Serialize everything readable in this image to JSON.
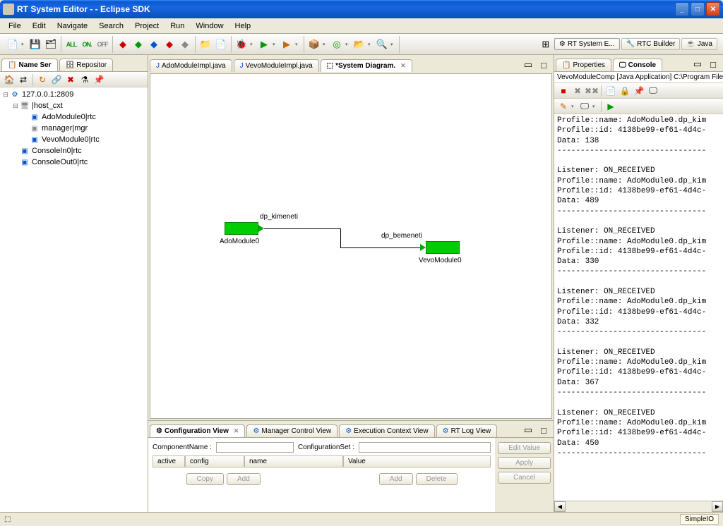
{
  "window": {
    "title": "RT System Editor -  - Eclipse SDK"
  },
  "menu": [
    "File",
    "Edit",
    "Navigate",
    "Search",
    "Project",
    "Run",
    "Window",
    "Help"
  ],
  "toolbar": {
    "all": "ALL",
    "on": "ON.",
    "off": "OFF"
  },
  "perspectives": [
    {
      "label": "RT System E...",
      "active": true
    },
    {
      "label": "RTC Builder",
      "active": false
    },
    {
      "label": "Java",
      "active": false
    }
  ],
  "left_view": {
    "tabs": [
      {
        "label": "Name Ser",
        "active": true
      },
      {
        "label": "Repositor",
        "active": false
      }
    ],
    "tree": {
      "root": "127.0.0.1:2809",
      "host": "|host_cxt",
      "children": [
        "AdoModule0|rtc",
        "manager|mgr",
        "VevoModule0|rtc"
      ],
      "siblings": [
        "ConsoleIn0|rtc",
        "ConsoleOut0|rtc"
      ]
    }
  },
  "editor": {
    "tabs": [
      {
        "label": "AdoModuleImpl.java",
        "active": false
      },
      {
        "label": "VevoModuleImpl.java",
        "active": false
      },
      {
        "label": "*System Diagram.",
        "active": true
      }
    ],
    "diagram": {
      "comp1": {
        "label": "AdoModule0"
      },
      "comp2": {
        "label": "VevoModule0"
      },
      "port_out": "dp_kimeneti",
      "port_in": "dp_bemeneti"
    }
  },
  "bottom_view": {
    "tabs": [
      "Configuration View",
      "Manager Control View",
      "Execution Context View",
      "RT Log View"
    ],
    "config": {
      "componentNameLabel": "ComponentName :",
      "configurationSetLabel": "ConfigurationSet :",
      "componentName": "",
      "configurationSet": "",
      "columns": [
        "active",
        "config",
        "name",
        "Value"
      ],
      "buttons": {
        "copy": "Copy",
        "add": "Add",
        "add2": "Add",
        "delete": "Delete",
        "editValue": "Edit Value",
        "apply": "Apply",
        "cancel": "Cancel"
      }
    }
  },
  "right_view": {
    "tabs": [
      {
        "label": "Properties",
        "active": false
      },
      {
        "label": "Console",
        "active": true
      }
    ],
    "console_info": "VevoModuleComp [Java Application] C:\\Program Files\\Ja",
    "console_output": "Profile::name: AdoModule0.dp_kim\nProfile::id: 4138be99-ef61-4d4c-\nData: 138\n--------------------------------\n\nListener: ON_RECEIVED\nProfile::name: AdoModule0.dp_kim\nProfile::id: 4138be99-ef61-4d4c-\nData: 489\n--------------------------------\n\nListener: ON_RECEIVED\nProfile::name: AdoModule0.dp_kim\nProfile::id: 4138be99-ef61-4d4c-\nData: 330\n--------------------------------\n\nListener: ON_RECEIVED\nProfile::name: AdoModule0.dp_kim\nProfile::id: 4138be99-ef61-4d4c-\nData: 332\n--------------------------------\n\nListener: ON_RECEIVED\nProfile::name: AdoModule0.dp_kim\nProfile::id: 4138be99-ef61-4d4c-\nData: 367\n--------------------------------\n\nListener: ON_RECEIVED\nProfile::name: AdoModule0.dp_kim\nProfile::id: 4138be99-ef61-4d4c-\nData: 450\n--------------------------------"
  },
  "status": {
    "tooltip": "SimpleIO"
  }
}
